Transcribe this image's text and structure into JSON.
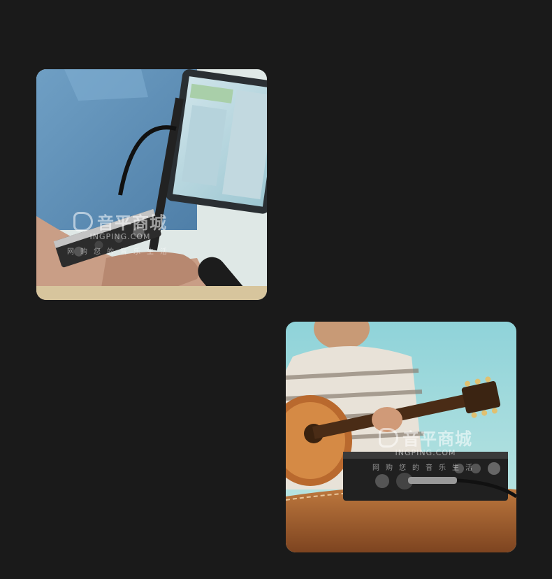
{
  "photos": [
    {
      "name": "audio-interface-on-strap-photo",
      "watermark": {
        "logo_text": "音平商城",
        "url_text": "INGPING.COM",
        "slogan": "网购您的音乐生活"
      }
    },
    {
      "name": "guitarist-with-interface-photo",
      "watermark": {
        "logo_text": "音平商城",
        "url_text": "INGPING.COM",
        "slogan": "网购您的音乐生活"
      }
    }
  ]
}
